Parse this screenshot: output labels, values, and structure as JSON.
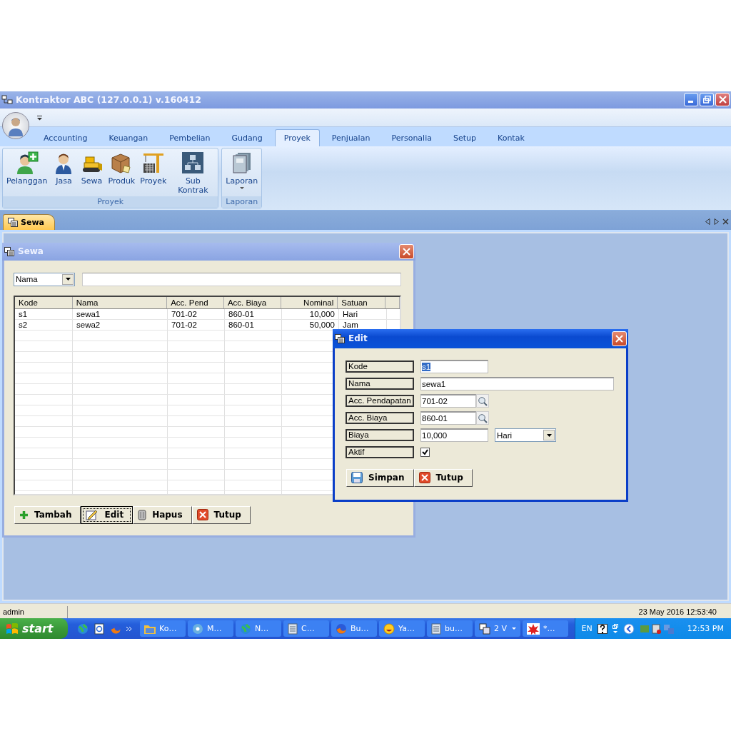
{
  "window": {
    "title": "Kontraktor ABC (127.0.0.1) v.160412"
  },
  "ribbon_tabs": [
    {
      "label": "Accounting",
      "selected": false
    },
    {
      "label": "Keuangan",
      "selected": false
    },
    {
      "label": "Pembelian",
      "selected": false
    },
    {
      "label": "Gudang",
      "selected": false
    },
    {
      "label": "Proyek",
      "selected": true
    },
    {
      "label": "Penjualan",
      "selected": false
    },
    {
      "label": "Personalia",
      "selected": false
    },
    {
      "label": "Setup",
      "selected": false
    },
    {
      "label": "Kontak",
      "selected": false
    }
  ],
  "ribbon_groups": [
    {
      "label": "Proyek",
      "buttons": [
        {
          "label": "Pelanggan",
          "kind": "customer"
        },
        {
          "label": "Jasa",
          "kind": "person"
        },
        {
          "label": "Sewa",
          "kind": "bulldozer"
        },
        {
          "label": "Produk",
          "kind": "box"
        },
        {
          "label": "Proyek",
          "kind": "crane"
        },
        {
          "label": "Sub Kontrak",
          "kind": "chart"
        }
      ]
    },
    {
      "label": "Laporan",
      "buttons": [
        {
          "label": "Laporan",
          "kind": "books",
          "dropdown": true
        }
      ]
    }
  ],
  "document_tabs": [
    {
      "label": "Sewa",
      "selected": true
    }
  ],
  "list_window": {
    "title": "Sewa",
    "active": false,
    "search": {
      "field": "Nama"
    },
    "table": {
      "columns": [
        {
          "label": "Kode",
          "kind": "text"
        },
        {
          "label": "Nama",
          "kind": "text"
        },
        {
          "label": "Acc. Pend",
          "kind": "text"
        },
        {
          "label": "Acc. Biaya",
          "kind": "text"
        },
        {
          "label": "Nominal",
          "kind": "number"
        },
        {
          "label": "Satuan",
          "kind": "text"
        }
      ],
      "rows": [
        [
          "s1",
          "sewa1",
          "701-02",
          "860-01",
          "10,000",
          "Hari"
        ],
        [
          "s2",
          "sewa2",
          "701-02",
          "860-01",
          "50,000",
          "Jam"
        ]
      ]
    },
    "buttons": [
      {
        "label": "Tambah",
        "kind": "add",
        "focused": false
      },
      {
        "label": "Edit",
        "kind": "edit",
        "focused": true
      },
      {
        "label": "Hapus",
        "kind": "delete",
        "focused": false
      },
      {
        "label": "Tutup",
        "kind": "close",
        "focused": false
      }
    ]
  },
  "edit_dialog": {
    "title": "Edit",
    "active": true,
    "fields": [
      {
        "label": "Kode",
        "kind": "text",
        "value": "s1",
        "highlighted": true
      },
      {
        "label": "Nama",
        "kind": "wide",
        "value": "sewa1",
        "highlighted": false
      },
      {
        "label": "Acc. Pendapatan",
        "kind": "lookup",
        "value": "701-02"
      },
      {
        "label": "Acc. Biaya",
        "kind": "lookup",
        "value": "860-01"
      },
      {
        "label": "Biaya",
        "kind": "amount",
        "value": "10,000",
        "unit": "Hari"
      },
      {
        "label": "Aktif",
        "kind": "checkbox",
        "checked": true
      }
    ],
    "buttons": [
      {
        "label": "Simpan",
        "kind": "save"
      },
      {
        "label": "Tutup",
        "kind": "close"
      }
    ]
  },
  "status_bar": {
    "user": "admin",
    "datetime": "23 May 2016  12:53:40"
  },
  "taskbar": {
    "start": "start",
    "tasks": [
      {
        "label": "Ko…",
        "kind": "folder"
      },
      {
        "label": "M…",
        "kind": "disc"
      },
      {
        "label": "N…",
        "kind": "globe"
      },
      {
        "label": "C…",
        "kind": "document"
      },
      {
        "label": "Bu…",
        "kind": "browser"
      },
      {
        "label": "Ya…",
        "kind": "smiley"
      },
      {
        "label": "bu…",
        "kind": "document"
      },
      {
        "label": "2 V",
        "kind": "stack",
        "dropdown": true
      },
      {
        "label": "*…",
        "kind": "splat"
      }
    ],
    "language": "EN",
    "clock": "12:53 PM"
  }
}
